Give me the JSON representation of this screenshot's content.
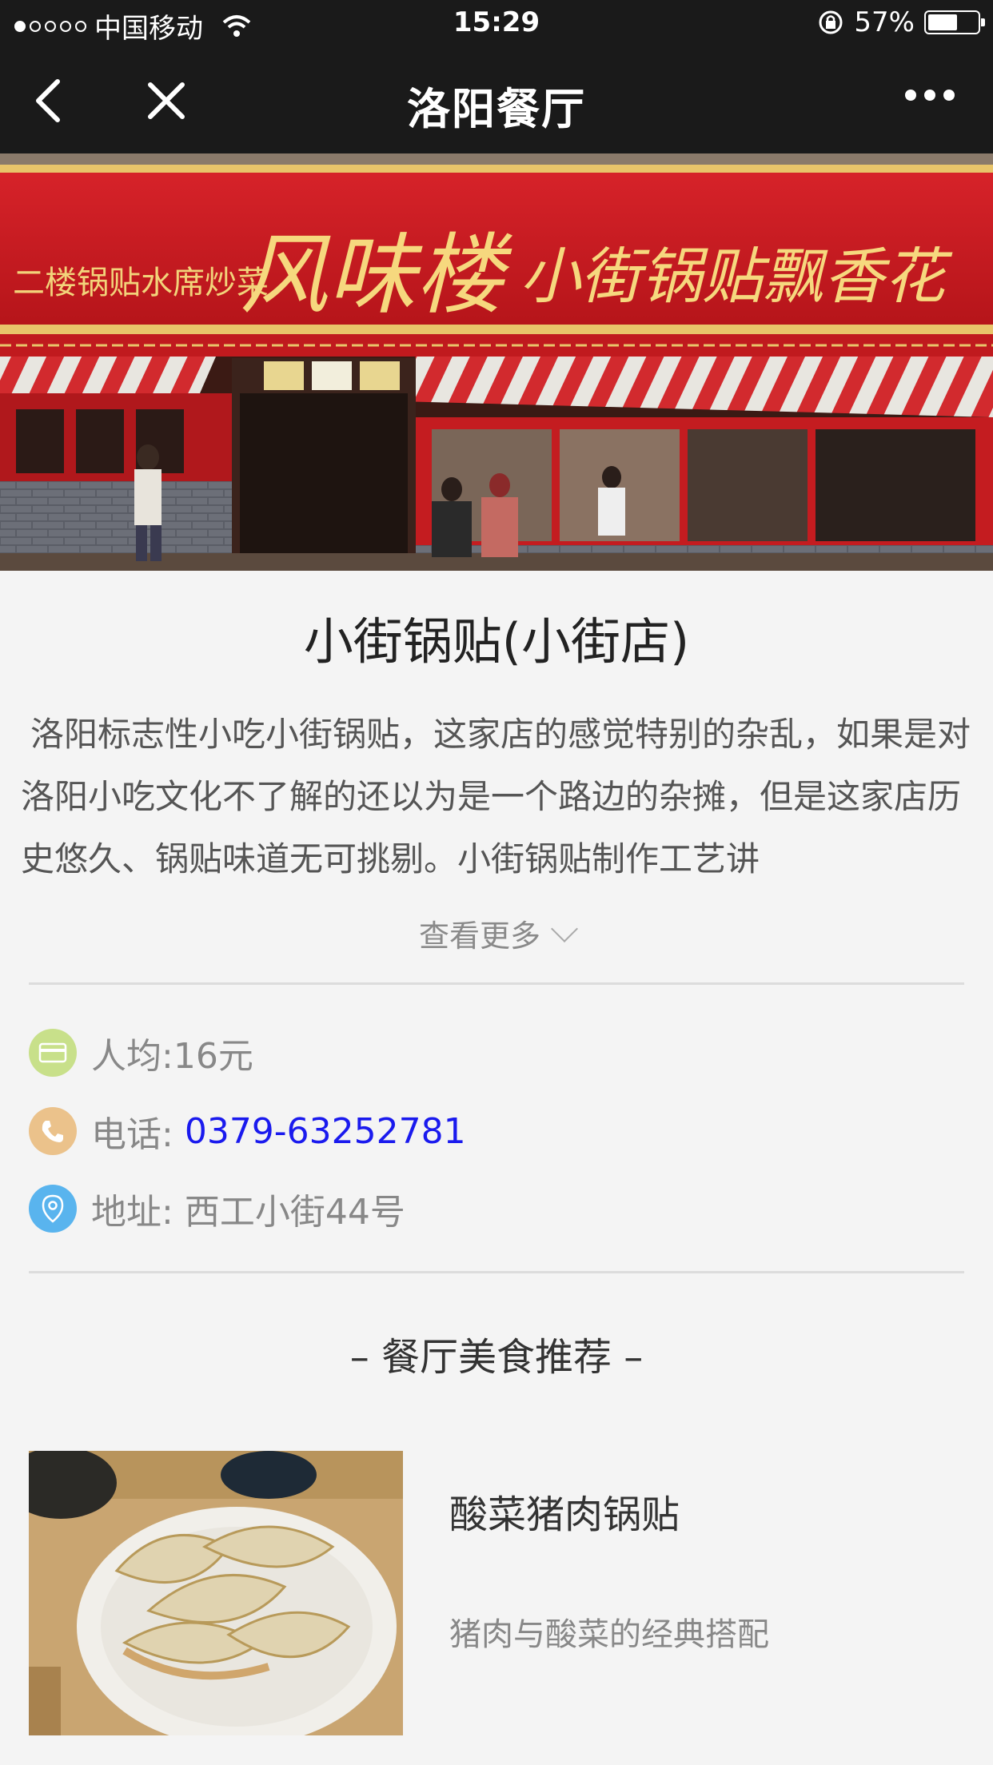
{
  "status_bar": {
    "carrier": "中国移动",
    "time": "15:29",
    "battery": "57%"
  },
  "nav": {
    "title": "洛阳餐厅"
  },
  "hero": {
    "sign_text_small": "二楼锅贴水席炒菜",
    "sign_text_main": "风味楼",
    "sign_text_right": "小街锅贴飘香花"
  },
  "store": {
    "title": "小街锅贴(小街店)",
    "description": "洛阳标志性小吃小街锅贴，这家店的感觉特别的杂乱，如果是对洛阳小吃文化不了解的还以为是一个路边的杂摊，但是这家店历史悠久、锅贴味道无可挑剔。小街锅贴制作工艺讲",
    "more_label": "查看更多"
  },
  "info": {
    "price_label": "人均: ",
    "price_value": "16元",
    "phone_label": "电话: ",
    "phone_value": "0379-63252781",
    "address_label": "地址: ",
    "address_value": "西工小街44号"
  },
  "section": {
    "title": "– 餐厅美食推荐 –"
  },
  "dishes": [
    {
      "name": "酸菜猪肉锅贴",
      "desc": "猪肉与酸菜的经典搭配"
    }
  ]
}
